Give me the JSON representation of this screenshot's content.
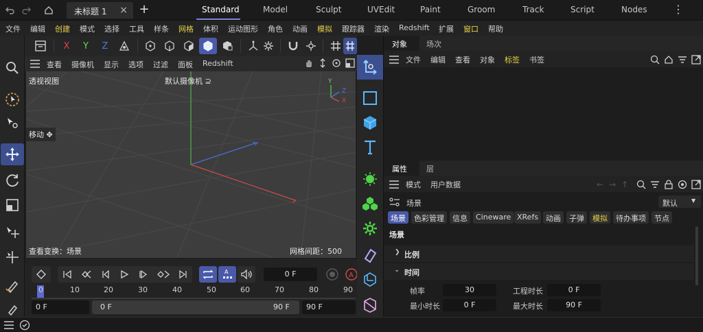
{
  "topbar": {
    "doc_tab": "未标题 1",
    "close": "×",
    "add": "+",
    "layouts": [
      "Standard",
      "Model",
      "Sculpt",
      "UVEdit",
      "Paint",
      "Groom",
      "Track",
      "Script",
      "Nodes"
    ],
    "more": "⋮"
  },
  "menu": [
    "文件",
    "编辑",
    "创建",
    "模式",
    "选择",
    "工具",
    "样条",
    "网格",
    "体积",
    "运动图形",
    "角色",
    "动画",
    "模拟",
    "跟踪器",
    "渲染",
    "Redshift",
    "扩展",
    "窗口",
    "帮助"
  ],
  "viewport": {
    "header": [
      "查看",
      "摄像机",
      "显示",
      "选项",
      "过滤",
      "面板",
      "Redshift"
    ],
    "name": "透视视图",
    "camera": "默认摄像机 ⊇",
    "move": "移动 ✥",
    "status_left": "查看变换：场景",
    "status_right": "网格间距：500 cm",
    "axes": {
      "x": "X",
      "y": "Y",
      "z": "Z"
    }
  },
  "timeline": {
    "current_frame": "0 F",
    "ruler": [
      "0",
      "10",
      "20",
      "30",
      "40",
      "50",
      "60",
      "70",
      "80",
      "90"
    ],
    "start": "0 F",
    "range_start": "0 F",
    "range_end": "90 F",
    "end": "90 F"
  },
  "objects": {
    "tabs": [
      "对象",
      "场次"
    ],
    "menu": [
      "文件",
      "编辑",
      "查看",
      "对象",
      "标签",
      "书签"
    ]
  },
  "attributes": {
    "tabs": [
      "属性",
      "层"
    ],
    "menu": [
      "模式",
      "用户数据"
    ],
    "scene_label": "场景",
    "preset": "默认",
    "chips": [
      "场景",
      "色彩管理",
      "信息",
      "Cineware",
      "XRefs",
      "动画",
      "子弹",
      "模拟",
      "待办事项",
      "节点"
    ],
    "section_title": "场景",
    "groups": [
      "比例",
      "时间"
    ],
    "fields": {
      "fps_label": "帧率",
      "fps": "30",
      "project_len_label": "工程时长",
      "project_len": "0 F",
      "min_label": "最小时长",
      "min": "0 F",
      "max_label": "最大时长",
      "max": "90 F"
    }
  },
  "colors": {
    "accent": "#4a5aa8",
    "highlight": "#e5cf4a",
    "x_axis": "#e0424a",
    "y_axis": "#6bd45a",
    "z_axis": "#4a7ae0"
  }
}
